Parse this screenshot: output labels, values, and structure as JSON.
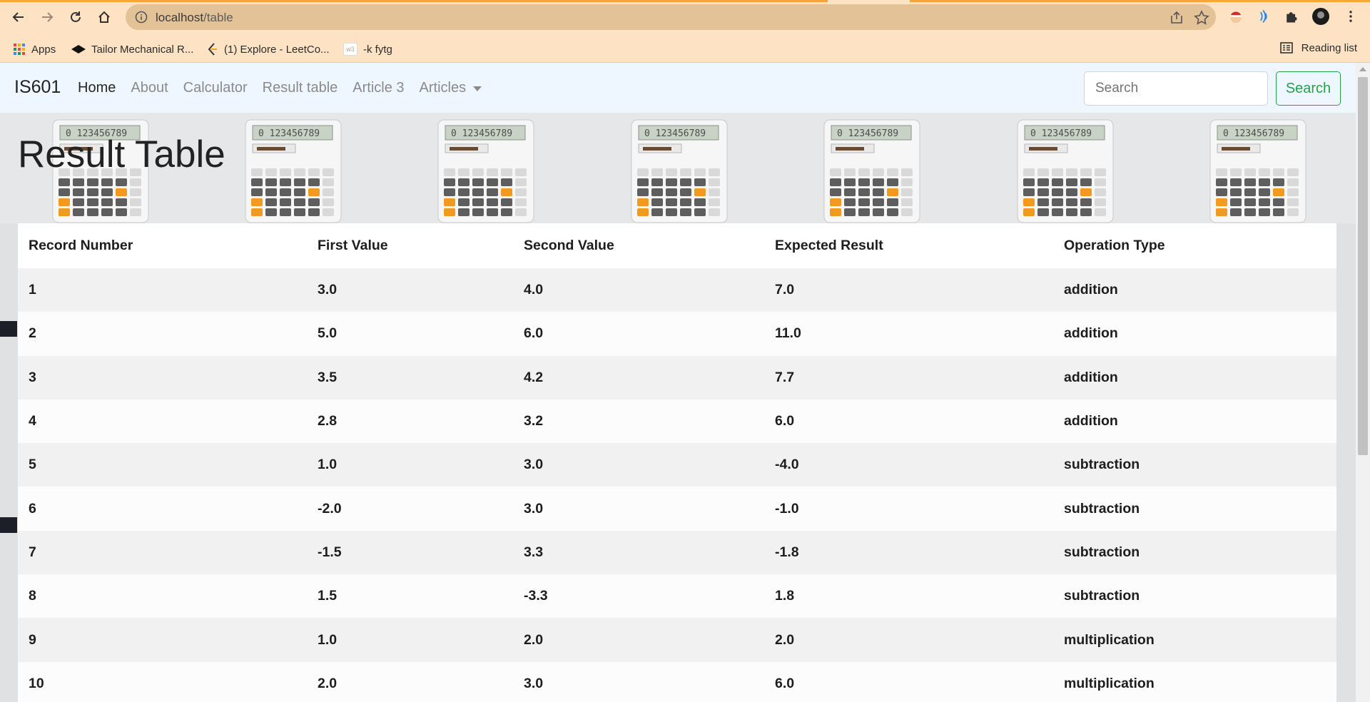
{
  "browser": {
    "url_host": "localhost",
    "url_path": "/table",
    "bookmarks": [
      {
        "label": "Apps",
        "icon": "apps-grid-icon"
      },
      {
        "label": "Tailor Mechanical R...",
        "icon": "tailor-logo-icon"
      },
      {
        "label": "(1) Explore - LeetCo...",
        "icon": "leetcode-icon"
      },
      {
        "label": "-k fytg",
        "icon": "w3schools-icon"
      }
    ],
    "reading_list": "Reading list",
    "colors": {
      "frame": "#fde3c4",
      "omnibox": "#e3c298",
      "accent": "#f5a53a"
    }
  },
  "navbar": {
    "brand": "IS601",
    "links": [
      {
        "label": "Home",
        "active": true
      },
      {
        "label": "About",
        "active": false
      },
      {
        "label": "Calculator",
        "active": false
      },
      {
        "label": "Result table",
        "active": false
      },
      {
        "label": "Article 3",
        "active": false
      },
      {
        "label": "Articles",
        "active": false,
        "dropdown": true
      }
    ],
    "search_placeholder": "Search",
    "search_button": "Search",
    "colors": {
      "background": "#eef7ff",
      "search_button": "#2a9d4a"
    }
  },
  "page": {
    "title": "Result Table",
    "calculator_display": "0 123456789"
  },
  "table": {
    "headers": [
      "Record Number",
      "First Value",
      "Second Value",
      "Expected Result",
      "Operation Type"
    ],
    "rows": [
      [
        "1",
        "3.0",
        "4.0",
        "7.0",
        "addition"
      ],
      [
        "2",
        "5.0",
        "6.0",
        "11.0",
        "addition"
      ],
      [
        "3",
        "3.5",
        "4.2",
        "7.7",
        "addition"
      ],
      [
        "4",
        "2.8",
        "3.2",
        "6.0",
        "addition"
      ],
      [
        "5",
        "1.0",
        "3.0",
        "-4.0",
        "subtraction"
      ],
      [
        "6",
        "-2.0",
        "3.0",
        "-1.0",
        "subtraction"
      ],
      [
        "7",
        "-1.5",
        "3.3",
        "-1.8",
        "subtraction"
      ],
      [
        "8",
        "1.5",
        "-3.3",
        "1.8",
        "subtraction"
      ],
      [
        "9",
        "1.0",
        "2.0",
        "2.0",
        "multiplication"
      ],
      [
        "10",
        "2.0",
        "3.0",
        "6.0",
        "multiplication"
      ]
    ]
  }
}
